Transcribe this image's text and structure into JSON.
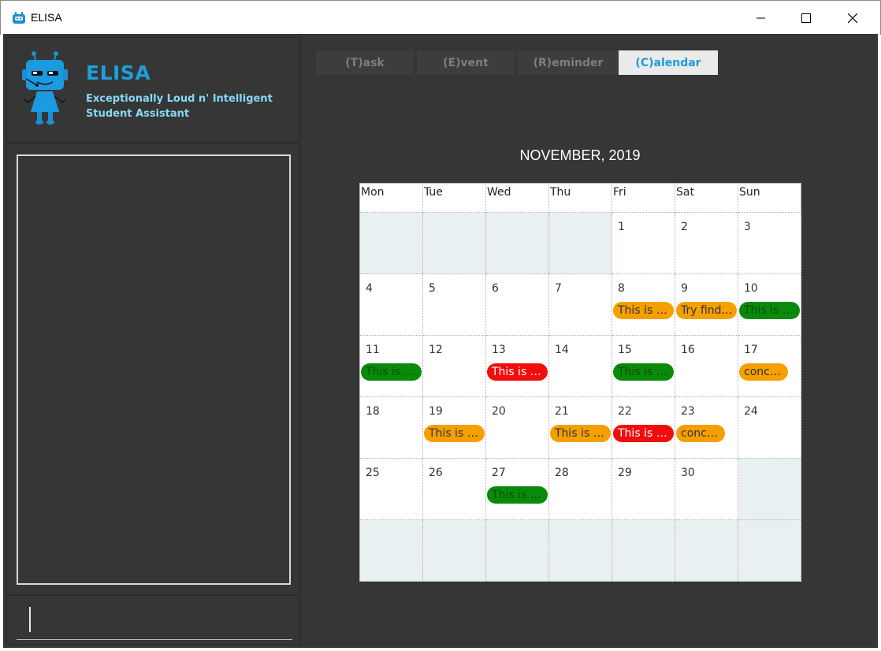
{
  "window": {
    "title": "ELISA",
    "minimize": "minimize-icon",
    "maximize": "maximize-icon",
    "close": "close-icon"
  },
  "brand": {
    "title": "ELISA",
    "subtitle_line1": "Exceptionally Loud n' Intelligent",
    "subtitle_line2": "Student Assistant",
    "logo": "robot-mascot"
  },
  "tabs": [
    {
      "label": "(T)ask",
      "active": false
    },
    {
      "label": "(E)vent",
      "active": false
    },
    {
      "label": "(R)eminder",
      "active": false
    },
    {
      "label": "(C)alendar",
      "active": true
    }
  ],
  "calendar": {
    "month_title": "NOVEMBER, 2019",
    "weekdays": [
      "Mon",
      "Tue",
      "Wed",
      "Thu",
      "Fri",
      "Sat",
      "Sun"
    ],
    "weeks": [
      [
        null,
        null,
        null,
        null,
        {
          "day": "1"
        },
        {
          "day": "2"
        },
        {
          "day": "3"
        }
      ],
      [
        {
          "day": "4"
        },
        {
          "day": "5"
        },
        {
          "day": "6"
        },
        {
          "day": "7"
        },
        {
          "day": "8",
          "event": {
            "label": "This is a...",
            "color": "#f59f00",
            "text_color": "#333333"
          }
        },
        {
          "day": "9",
          "event": {
            "label": "Try find...",
            "color": "#f59f00",
            "text_color": "#333333"
          }
        },
        {
          "day": "10",
          "event": {
            "label": "This is a...",
            "color": "#0a8a0a",
            "text_color": "#0b4d0b"
          }
        }
      ],
      [
        {
          "day": "11",
          "event": {
            "label": "This is a...",
            "color": "#0a8a0a",
            "text_color": "#0b4d0b"
          }
        },
        {
          "day": "12"
        },
        {
          "day": "13",
          "event": {
            "label": "This is e...",
            "color": "#f20d0d",
            "text_color": "#ffffff"
          }
        },
        {
          "day": "14"
        },
        {
          "day": "15",
          "event": {
            "label": "This is e...",
            "color": "#0a8a0a",
            "text_color": "#0b4d0b"
          }
        },
        {
          "day": "16"
        },
        {
          "day": "17",
          "event": {
            "label": "concert",
            "color": "#f59f00",
            "text_color": "#333333",
            "short": true
          }
        }
      ],
      [
        {
          "day": "18"
        },
        {
          "day": "19",
          "event": {
            "label": "This is e...",
            "color": "#f59f00",
            "text_color": "#333333"
          }
        },
        {
          "day": "20"
        },
        {
          "day": "21",
          "event": {
            "label": "This is e...",
            "color": "#f59f00",
            "text_color": "#333333"
          }
        },
        {
          "day": "22",
          "event": {
            "label": "This is a...",
            "color": "#f20d0d",
            "text_color": "#ffffff"
          }
        },
        {
          "day": "23",
          "event": {
            "label": "concert",
            "color": "#f59f00",
            "text_color": "#333333",
            "short": true
          }
        },
        {
          "day": "24"
        }
      ],
      [
        {
          "day": "25"
        },
        {
          "day": "26"
        },
        {
          "day": "27",
          "event": {
            "label": "This is e...",
            "color": "#0a8a0a",
            "text_color": "#0b4d0b"
          }
        },
        {
          "day": "28"
        },
        {
          "day": "29"
        },
        {
          "day": "30"
        },
        null
      ],
      [
        null,
        null,
        null,
        null,
        null,
        null,
        null
      ]
    ]
  },
  "colors": {
    "accent": "#1ba0d8",
    "background": "#363636",
    "event_orange": "#f59f00",
    "event_green": "#0a8a0a",
    "event_red": "#f20d0d"
  }
}
